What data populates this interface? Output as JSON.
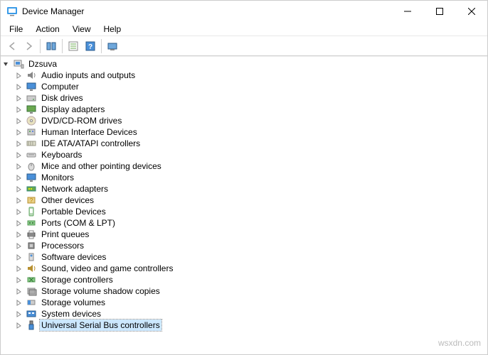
{
  "window": {
    "title": "Device Manager"
  },
  "menu": {
    "file": "File",
    "action": "Action",
    "view": "View",
    "help": "Help"
  },
  "toolbar": {
    "back": "back-icon",
    "forward": "forward-icon",
    "up": "folder-up-icon",
    "props": "properties-icon",
    "help": "help-icon",
    "monitors": "show-hidden-icon"
  },
  "root": {
    "label": "Dzsuva"
  },
  "categories": [
    {
      "label": "Audio inputs and outputs",
      "icon": "speaker"
    },
    {
      "label": "Computer",
      "icon": "monitor"
    },
    {
      "label": "Disk drives",
      "icon": "disk"
    },
    {
      "label": "Display adapters",
      "icon": "display"
    },
    {
      "label": "DVD/CD-ROM drives",
      "icon": "cd"
    },
    {
      "label": "Human Interface Devices",
      "icon": "hid"
    },
    {
      "label": "IDE ATA/ATAPI controllers",
      "icon": "ide"
    },
    {
      "label": "Keyboards",
      "icon": "keyboard"
    },
    {
      "label": "Mice and other pointing devices",
      "icon": "mouse"
    },
    {
      "label": "Monitors",
      "icon": "monitor2"
    },
    {
      "label": "Network adapters",
      "icon": "network"
    },
    {
      "label": "Other devices",
      "icon": "other"
    },
    {
      "label": "Portable Devices",
      "icon": "portable"
    },
    {
      "label": "Ports (COM & LPT)",
      "icon": "port"
    },
    {
      "label": "Print queues",
      "icon": "printer"
    },
    {
      "label": "Processors",
      "icon": "cpu"
    },
    {
      "label": "Software devices",
      "icon": "software"
    },
    {
      "label": "Sound, video and game controllers",
      "icon": "sound"
    },
    {
      "label": "Storage controllers",
      "icon": "storage"
    },
    {
      "label": "Storage volume shadow copies",
      "icon": "shadow"
    },
    {
      "label": "Storage volumes",
      "icon": "volume"
    },
    {
      "label": "System devices",
      "icon": "system"
    },
    {
      "label": "Universal Serial Bus controllers",
      "icon": "usb",
      "selected": true
    }
  ],
  "watermark": "wsxdn.com"
}
